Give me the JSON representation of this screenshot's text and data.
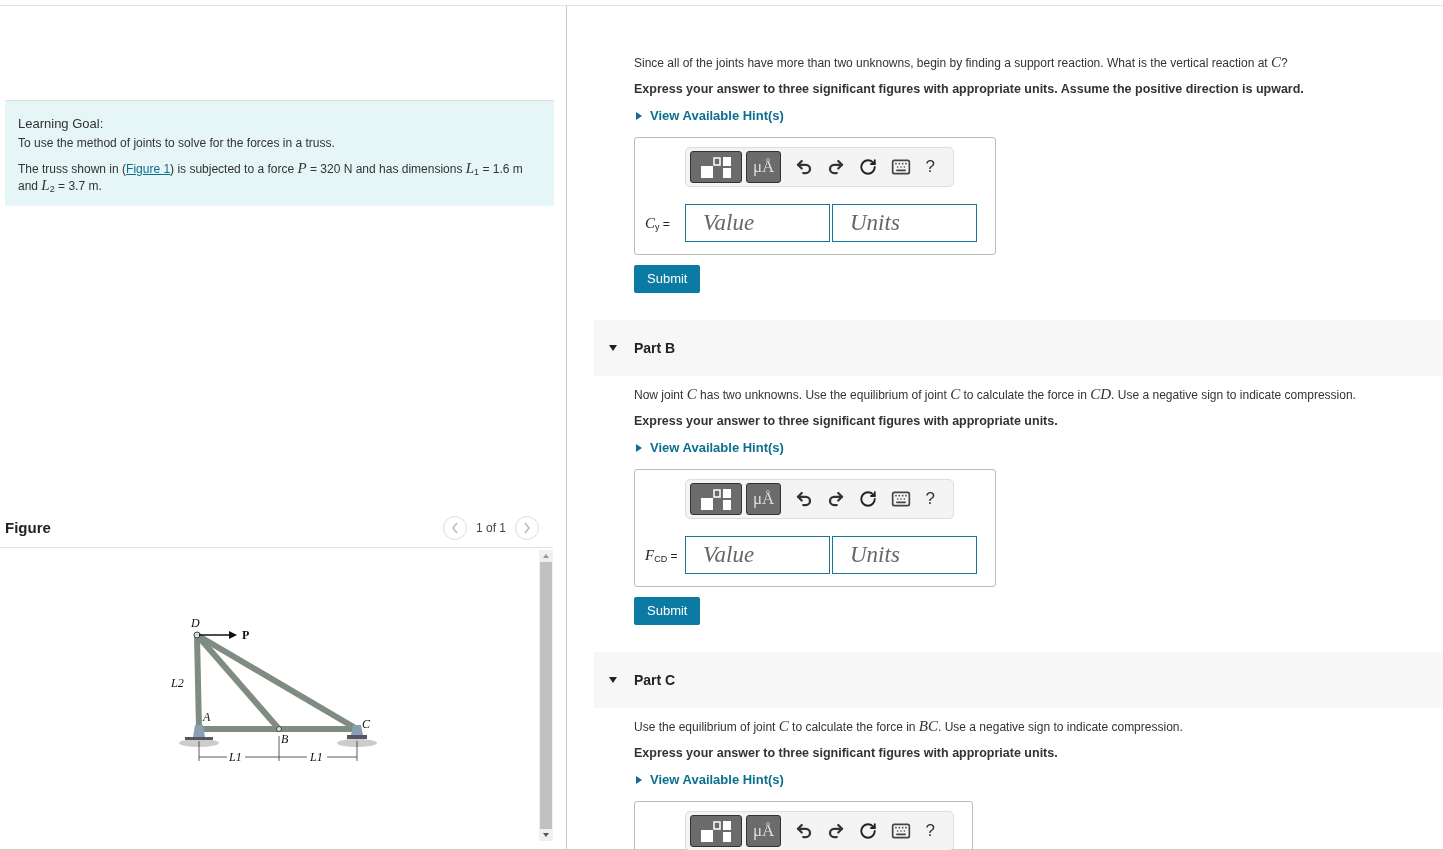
{
  "learning_goal": {
    "heading": "Learning Goal:",
    "text": "To use the method of joints to solve for the forces in a truss.",
    "statement_before": "The truss shown in (",
    "figure_link": "Figure 1",
    "statement_after": ") is subjected to a force *P* = 320 N and has dimensions *L*$_{1}$ = 1.6 m and *L*$_{2}$ = 3.7 m."
  },
  "figure": {
    "title": "Figure",
    "pager": "1 of 1",
    "labels": {
      "d": "D",
      "p": "P",
      "l2": "L2",
      "a": "A",
      "b": "B",
      "c": "C",
      "l1_left": "L1",
      "l1_right": "L1"
    }
  },
  "parts": [
    {
      "prompt": "Since all of the joints have more than two unknowns, begin by finding a support reaction. What is the vertical reaction at *C*?",
      "instruction": "Express your answer to three significant figures with appropriate units. Assume the positive direction is upward.",
      "hint_link": "View Available Hint(s)",
      "toolbar": {
        "units_button": "μÅ",
        "help": "?"
      },
      "answer": {
        "variable": "*C*$_{y}$ =",
        "value_placeholder": "Value",
        "units_placeholder": "Units",
        "submit": "Submit"
      }
    },
    {
      "header": {
        "title": "Part B",
        "expanded": true
      },
      "prompt": "Now joint *C* has two unknowns. Use the equilibrium of joint *C* to calculate the force in *CD*. Use a negative sign to indicate compression.",
      "instruction": "Express your answer to three significant figures with appropriate units.",
      "hint_link": "View Available Hint(s)",
      "toolbar": {
        "units_button": "μÅ",
        "help": "?"
      },
      "answer": {
        "variable": "*F*$_{CD}$ =",
        "value_placeholder": "Value",
        "units_placeholder": "Units",
        "submit": "Submit"
      }
    },
    {
      "header": {
        "title": "Part C",
        "expanded": true
      },
      "prompt": "Use the equilibrium of joint *C* to calculate the force in *BC*. Use a negative sign to indicate compression.",
      "instruction": "Express your answer to three significant figures with appropriate units.",
      "hint_link": "View Available Hint(s)",
      "toolbar": {
        "units_button": "μÅ",
        "help": "?"
      }
    }
  ]
}
